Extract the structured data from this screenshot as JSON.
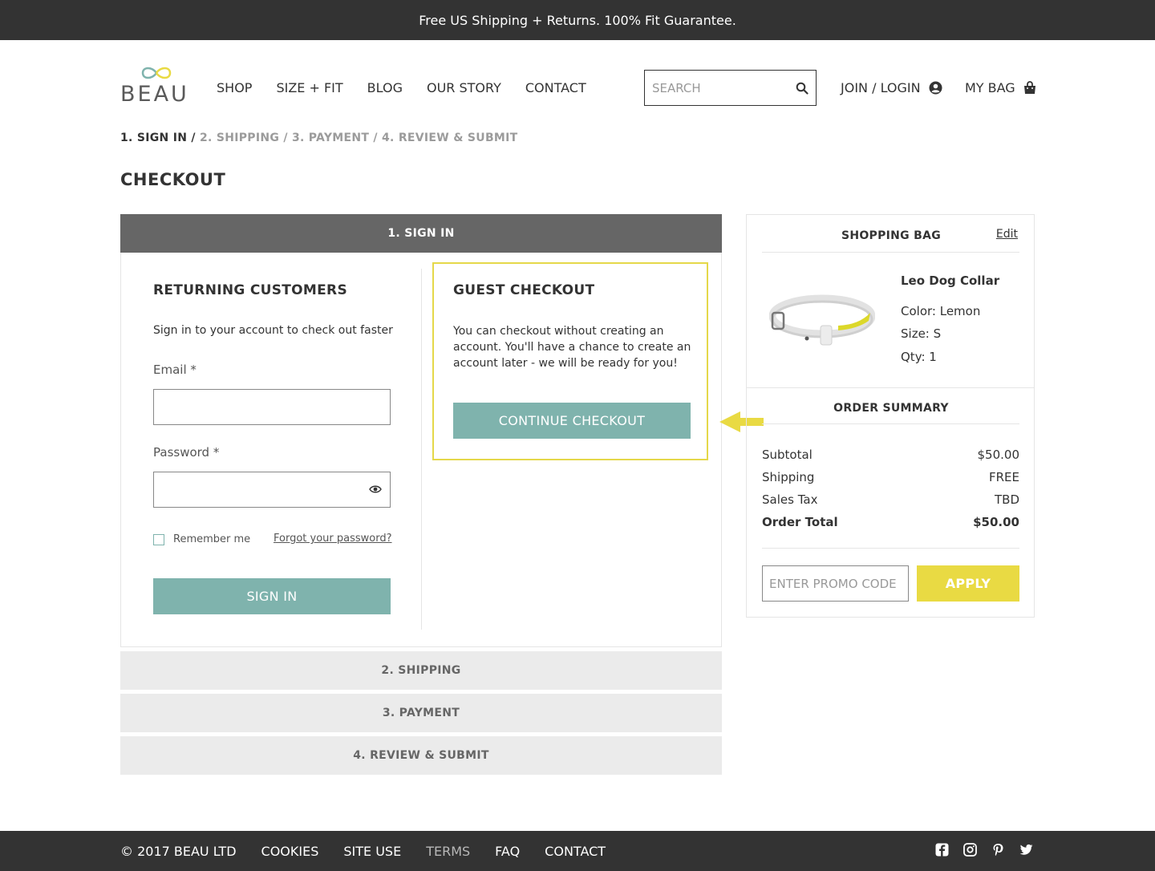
{
  "promo_bar": {
    "text": "Free US Shipping + Returns. 100% Fit Guarantee."
  },
  "header": {
    "logo_text": "BEAU",
    "nav": [
      "SHOP",
      "SIZE + FIT",
      "BLOG",
      "OUR STORY",
      "CONTACT"
    ],
    "search": {
      "placeholder": "SEARCH"
    },
    "account_label": "JOIN / LOGIN",
    "bag_label": "MY BAG"
  },
  "breadcrumb": {
    "active": "1. SIGN IN /",
    "rest": " 2. SHIPPING / 3. PAYMENT / 4. REVIEW & SUBMIT"
  },
  "page_title": "CHECKOUT",
  "steps": {
    "sign_in": "1. SIGN IN",
    "shipping": "2. SHIPPING",
    "payment": "3. PAYMENT",
    "review": "4. REVIEW & SUBMIT"
  },
  "returning": {
    "title": "RETURNING CUSTOMERS",
    "subtitle": "Sign in to your account to check out faster",
    "email_label": "Email *",
    "email_value": "",
    "password_label": "Password *",
    "password_value": "",
    "remember_label": "Remember me",
    "forgot_label": "Forgot your password?",
    "signin_button": "SIGN IN"
  },
  "guest": {
    "title": "GUEST CHECKOUT",
    "text": "You can checkout without creating an account.  You'll have a chance to create an account later - we will be ready for you!",
    "button": "CONTINUE CHECKOUT"
  },
  "shopping_bag": {
    "title": "SHOPPING BAG",
    "edit_label": "Edit",
    "item": {
      "name": "Leo Dog Collar",
      "color": "Color: Lemon",
      "size": "Size: S",
      "qty": "Qty: 1"
    }
  },
  "order_summary": {
    "title": "ORDER SUMMARY",
    "rows": [
      {
        "label": "Subtotal",
        "value": "$50.00"
      },
      {
        "label": "Shipping",
        "value": "FREE"
      },
      {
        "label": "Sales Tax",
        "value": "TBD"
      },
      {
        "label": "Order Total",
        "value": "$50.00"
      }
    ],
    "promo_placeholder": "ENTER PROMO CODE",
    "apply_label": "APPLY"
  },
  "footer": {
    "links": [
      "© 2017 BEAU LTD",
      "COOKIES",
      "SITE USE",
      "TERMS",
      "FAQ",
      "CONTACT"
    ],
    "social_icons": [
      "facebook-icon",
      "instagram-icon",
      "pinterest-icon",
      "twitter-icon"
    ]
  },
  "colors": {
    "teal": "#7fb3ad",
    "yellow": "#e9da43",
    "dark": "#333333",
    "step_active": "#666666",
    "step_inactive": "#ebebeb"
  }
}
